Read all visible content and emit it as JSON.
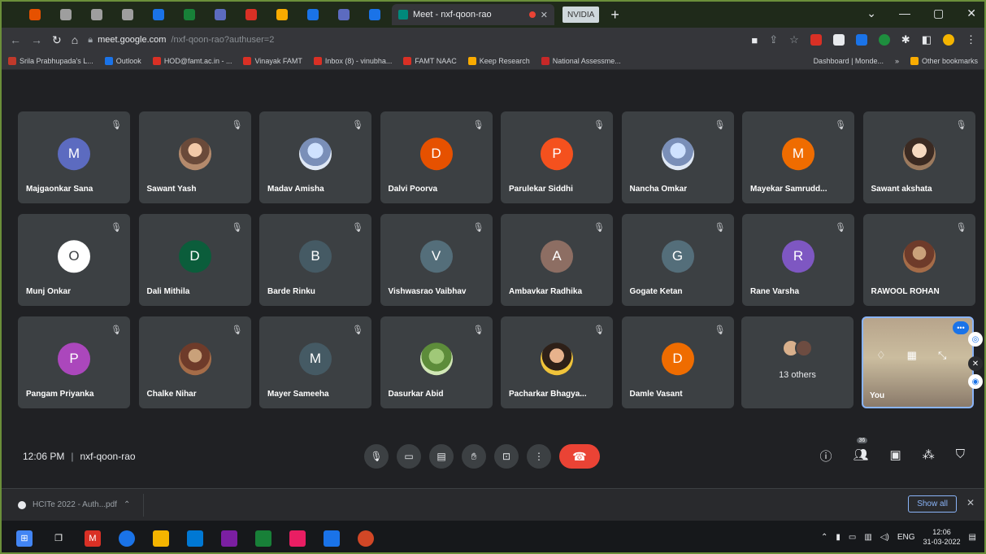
{
  "browser": {
    "active_tab_title": "Meet - nxf-qoon-rao",
    "second_tab_label": "NVIDIA",
    "url_host": "meet.google.com",
    "url_path": "/nxf-qoon-rao?authuser=2",
    "pinned_tab_colors": [
      "#e65100",
      "#9e9e9e",
      "#9e9e9e",
      "#9e9e9e",
      "#1a73e8",
      "#188038",
      "#5c6bc0",
      "#d93025",
      "#f9ab00",
      "#1a73e8",
      "#5c6bc0",
      "#1a73e8"
    ]
  },
  "bookmarks": [
    {
      "label": "Srila Prabhupada's L...",
      "color": "#c0392b"
    },
    {
      "label": "Outlook",
      "color": "#1a73e8"
    },
    {
      "label": "HOD@famt.ac.in - ...",
      "color": "#d93025"
    },
    {
      "label": "Vinayak FAMT",
      "color": "#d93025"
    },
    {
      "label": "Inbox (8) - vinubha...",
      "color": "#d93025"
    },
    {
      "label": "FAMT NAAC",
      "color": "#d93025"
    },
    {
      "label": "Keep Research",
      "color": "#f9ab00"
    },
    {
      "label": "National Assessme...",
      "color": "#c62828"
    }
  ],
  "bookmarks_right": {
    "dashboard": "Dashboard | Monde...",
    "more": "»",
    "other": "Other bookmarks"
  },
  "participants": [
    {
      "name": "Majgaonkar Sana",
      "initial": "M",
      "color": "#5c6bc0",
      "type": "letter"
    },
    {
      "name": "Sawant Yash",
      "initial": "",
      "color": "",
      "type": "photo-a"
    },
    {
      "name": "Madav Amisha",
      "initial": "",
      "color": "",
      "type": "photo-b"
    },
    {
      "name": "Dalvi Poorva",
      "initial": "D",
      "color": "#e65100",
      "type": "letter"
    },
    {
      "name": "Parulekar Siddhi",
      "initial": "P",
      "color": "#f4511e",
      "type": "letter"
    },
    {
      "name": "Nancha Omkar",
      "initial": "",
      "color": "",
      "type": "photo-b"
    },
    {
      "name": "Mayekar Samrudd...",
      "initial": "M",
      "color": "#ef6c00",
      "type": "letter"
    },
    {
      "name": "Sawant akshata",
      "initial": "",
      "color": "",
      "type": "photo-c"
    },
    {
      "name": "Munj Onkar",
      "initial": "O",
      "color": "#ffffff",
      "type": "ring"
    },
    {
      "name": "Dali Mithila",
      "initial": "D",
      "color": "#0b5d3b",
      "type": "letter"
    },
    {
      "name": "Barde Rinku",
      "initial": "B",
      "color": "#455a64",
      "type": "letter"
    },
    {
      "name": "Vishwasrao Vaibhav",
      "initial": "V",
      "color": "#546e7a",
      "type": "letter"
    },
    {
      "name": "Ambavkar Radhika",
      "initial": "A",
      "color": "#8d6e63",
      "type": "letter"
    },
    {
      "name": "Gogate Ketan",
      "initial": "G",
      "color": "#546e7a",
      "type": "letter"
    },
    {
      "name": "Rane Varsha",
      "initial": "R",
      "color": "#7e57c2",
      "type": "letter"
    },
    {
      "name": "RAWOOL ROHAN",
      "initial": "",
      "color": "",
      "type": "photo-f"
    },
    {
      "name": "Pangam Priyanka",
      "initial": "P",
      "color": "#ab47bc",
      "type": "letter"
    },
    {
      "name": "Chalke Nihar",
      "initial": "",
      "color": "",
      "type": "photo-f"
    },
    {
      "name": "Mayer Sameeha",
      "initial": "M",
      "color": "#455a64",
      "type": "letter"
    },
    {
      "name": "Dasurkar Abid",
      "initial": "",
      "color": "",
      "type": "photo-d"
    },
    {
      "name": "Pacharkar Bhagya...",
      "initial": "",
      "color": "",
      "type": "photo-e"
    },
    {
      "name": "Damle Vasant",
      "initial": "D",
      "color": "#ef6c00",
      "type": "letter"
    }
  ],
  "others_tile": {
    "label": "13 others"
  },
  "self_tile": {
    "label": "You"
  },
  "meeting": {
    "time": "12:06 PM",
    "separator": "|",
    "code": "nxf-qoon-rao",
    "people_count": "36"
  },
  "downloads": {
    "file": "HCITe 2022 - Auth...pdf",
    "show_all": "Show all"
  },
  "taskbar": {
    "lang": "ENG",
    "time": "12:06",
    "date": "31-03-2022"
  },
  "icons": {
    "mic_off": "mic-off-icon",
    "mic": "mic-icon",
    "camera": "camera-icon",
    "captions": "captions-icon",
    "hand": "raise-hand-icon",
    "present": "present-icon",
    "more": "more-icon",
    "end": "end-call-icon"
  }
}
